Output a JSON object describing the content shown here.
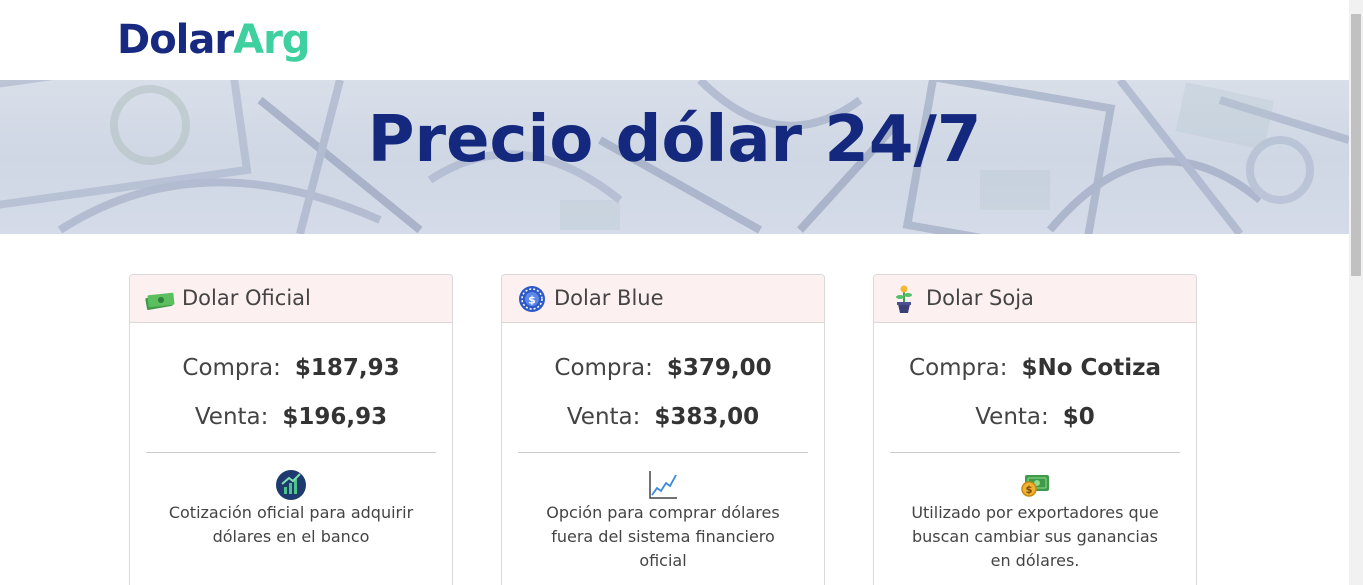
{
  "brand": {
    "part1": "Dolar",
    "part2": "Arg"
  },
  "hero": {
    "title": "Precio dólar 24/7"
  },
  "cards": [
    {
      "title": "Dolar Oficial",
      "icon": "money-stack-icon",
      "compra_label": "Compra:",
      "compra_value": "$187,93",
      "venta_label": "Venta:",
      "venta_value": "$196,93",
      "desc_icon": "growth-chart-icon",
      "description": "Cotización oficial para adquirir dólares en el banco"
    },
    {
      "title": "Dolar Blue",
      "icon": "dollar-coin-icon",
      "compra_label": "Compra:",
      "compra_value": "$379,00",
      "venta_label": "Venta:",
      "venta_value": "$383,00",
      "desc_icon": "line-chart-icon",
      "description": "Opción para comprar dólares fuera del sistema financiero oficial"
    },
    {
      "title": "Dolar Soja",
      "icon": "plant-pot-icon",
      "compra_label": "Compra:",
      "compra_value": "$No Cotiza",
      "venta_label": "Venta:",
      "venta_value": "$0",
      "desc_icon": "cash-coin-icon",
      "description": "Utilizado por exportadores que buscan cambiar sus ganancias en dólares."
    }
  ],
  "colors": {
    "brand_dark": "#172a80",
    "brand_accent": "#3fd0a0",
    "card_header_bg": "#fdf0f0"
  }
}
